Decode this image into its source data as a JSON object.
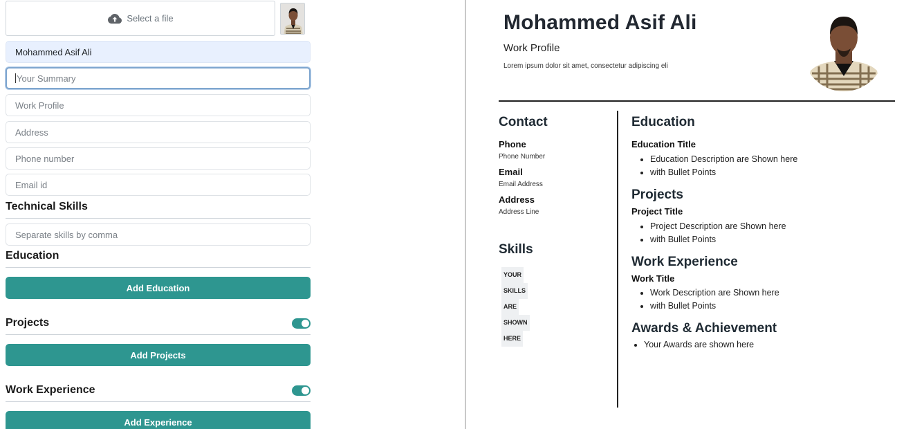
{
  "editor": {
    "upload_label": "Select a file",
    "name_value": "Mohammed Asif Ali",
    "summary_placeholder": "Your Summary",
    "work_profile_placeholder": "Work Profile",
    "address_placeholder": "Address",
    "phone_placeholder": "Phone number",
    "email_placeholder": "Email id",
    "technical_skills_heading": "Technical Skills",
    "skills_placeholder": "Separate skills by comma",
    "education_heading": "Education",
    "add_education_label": "Add Education",
    "projects_heading": "Projects",
    "add_projects_label": "Add Projects",
    "work_experience_heading": "Work Experience",
    "add_experience_label": "Add Experience",
    "projects_toggle_on": true,
    "work_toggle_on": true
  },
  "resume": {
    "name": "Mohammed Asif Ali",
    "work_profile": "Work Profile",
    "summary": "Lorem ipsum dolor sit amet, consectetur adipiscing eli",
    "contact_heading": "Contact",
    "phone_label": "Phone",
    "phone_value": "Phone Number",
    "email_label": "Email",
    "email_value": "Email Address",
    "address_label": "Address",
    "address_value": "Address Line",
    "skills_heading": "Skills",
    "skills": [
      "YOUR",
      "SKILLS",
      "ARE",
      "SHOWN",
      "HERE"
    ],
    "education_heading": "Education",
    "education_title": "Education Title",
    "education_bullets": [
      "Education Description are Shown here",
      "with Bullet Points"
    ],
    "projects_heading": "Projects",
    "project_title": "Project Title",
    "project_bullets": [
      "Project Description are Shown here",
      "with Bullet Points"
    ],
    "work_heading": "Work Experience",
    "work_title": "Work Title",
    "work_bullets": [
      "Work Description are Shown here",
      "with Bullet Points"
    ],
    "awards_heading": "Awards & Achievement",
    "awards_bullets": [
      "Your Awards are shown here"
    ]
  },
  "colors": {
    "accent": "#2e9690",
    "filled_field": "#e8f0fe"
  },
  "icons": {
    "upload": "cloud-upload-icon"
  }
}
